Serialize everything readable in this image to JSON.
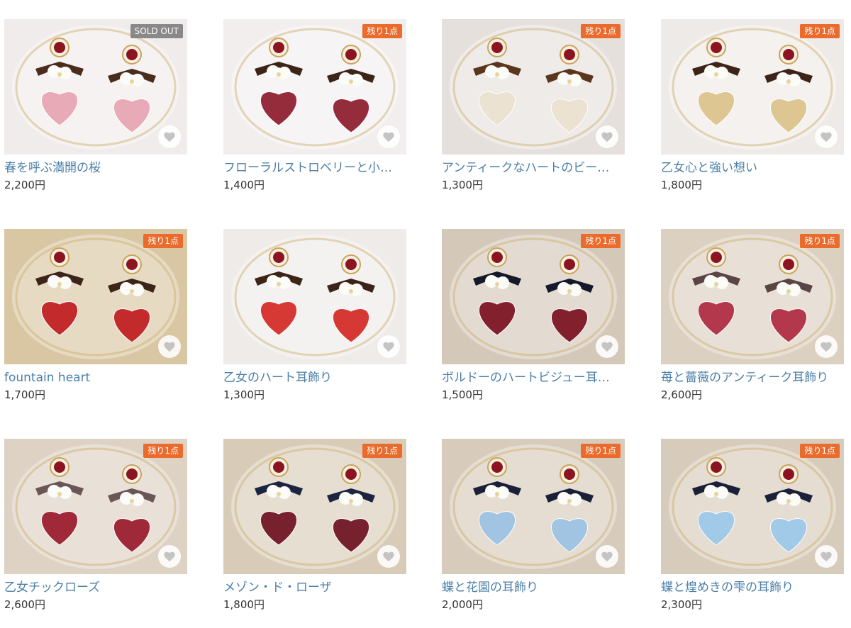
{
  "products": [
    {
      "title": "春を呼ぶ満開の桜",
      "price": "2,200円",
      "badge": "SOLD OUT",
      "badge_type": "sold",
      "bg": "#f1ecec",
      "accent": "#e8a4b2",
      "ribbon": "#4a2c1c"
    },
    {
      "title": "フローラルストロベリーと小…",
      "price": "1,400円",
      "badge": "残り1点",
      "badge_type": "last",
      "bg": "#f2eeee",
      "accent": "#8c1c2c",
      "ribbon": "#3d2418"
    },
    {
      "title": "アンティークなハートのビー…",
      "price": "1,300円",
      "badge": "残り1点",
      "badge_type": "last",
      "bg": "#e6e0dd",
      "accent": "#ece2cf",
      "ribbon": "#5a361d"
    },
    {
      "title": "乙女心と強い想い",
      "price": "1,800円",
      "badge": "残り1点",
      "badge_type": "last",
      "bg": "#eeeae7",
      "accent": "#dcc38a",
      "ribbon": "#3d2418"
    },
    {
      "title": "fountain heart",
      "price": "1,700円",
      "badge": "残り1点",
      "badge_type": "last",
      "bg": "#d9c7a4",
      "accent": "#c01c20",
      "ribbon": "#3d2418"
    },
    {
      "title": "乙女のハート耳飾り",
      "price": "1,300円",
      "badge": "",
      "badge_type": "",
      "bg": "#efebe9",
      "accent": "#d42a24",
      "ribbon": "#3d2418"
    },
    {
      "title": "ボルドーのハートビジュー耳…",
      "price": "1,500円",
      "badge": "残り1点",
      "badge_type": "last",
      "bg": "#d4c8b8",
      "accent": "#7a1220",
      "ribbon": "#141a2a"
    },
    {
      "title": "苺と薔薇のアンティーク耳飾り",
      "price": "2,600円",
      "badge": "残り1点",
      "badge_type": "last",
      "bg": "#dcd0c1",
      "accent": "#b02a40",
      "ribbon": "#5a4446"
    },
    {
      "title": "乙女チックローズ",
      "price": "2,600円",
      "badge": "残り1点",
      "badge_type": "last",
      "bg": "#ddd2c4",
      "accent": "#9a1a2c",
      "ribbon": "#6a5656"
    },
    {
      "title": "メゾン・ド・ローザ",
      "price": "1,800円",
      "badge": "残り1点",
      "badge_type": "last",
      "bg": "#d8ccb9",
      "accent": "#6e1222",
      "ribbon": "#1c2440"
    },
    {
      "title": "蝶と花園の耳飾り",
      "price": "2,000円",
      "badge": "残り1点",
      "badge_type": "last",
      "bg": "#d7cbbb",
      "accent": "#9cc2e4",
      "ribbon": "#1a2038"
    },
    {
      "title": "蝶と煌めきの雫の耳飾り",
      "price": "2,300円",
      "badge": "残り1点",
      "badge_type": "last",
      "bg": "#d7cbbb",
      "accent": "#9cc8ea",
      "ribbon": "#1a2038"
    }
  ]
}
